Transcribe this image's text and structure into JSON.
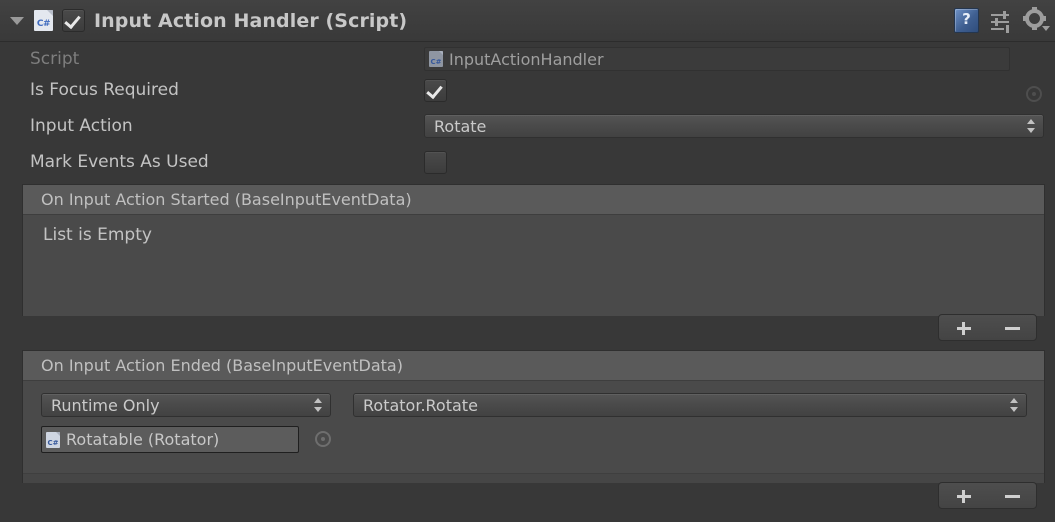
{
  "component": {
    "title": "Input Action Handler (Script)",
    "enabled_checkbox": true,
    "foldout_expanded": true,
    "icons": {
      "foldout": "triangle-down-icon",
      "script": "csharp-script-icon",
      "help": "help-book-icon",
      "preset": "preset-sliders-icon",
      "settings": "gear-dropdown-icon"
    }
  },
  "properties": {
    "script": {
      "label": "Script",
      "value": "InputActionHandler",
      "disabled": true,
      "picker": "object-picker-icon"
    },
    "is_focus_required": {
      "label": "Is Focus Required",
      "checked": true
    },
    "input_action": {
      "label": "Input Action",
      "value": "Rotate"
    },
    "mark_events_as_used": {
      "label": "Mark Events As Used",
      "checked": false
    }
  },
  "events": [
    {
      "header": "On Input Action Started (BaseInputEventData)",
      "empty_text": "List is Empty",
      "entries": [],
      "add_label": "+",
      "remove_label": "−"
    },
    {
      "header": "On Input Action Ended (BaseInputEventData)",
      "empty_text": "",
      "entries": [
        {
          "call_state": "Runtime Only",
          "method": "Rotator.Rotate",
          "target_object": "Rotatable (Rotator)",
          "target_icon": "csharp-script-icon",
          "picker": "object-picker-icon"
        }
      ],
      "add_label": "+",
      "remove_label": "−"
    }
  ],
  "colors": {
    "background": "#383838",
    "header_bg": "#3d3d3d",
    "event_box": "#4a4a4a",
    "event_header": "#5a5a5a",
    "text": "#c3c3c3",
    "text_dim": "#7e7e7e",
    "csharp_blue": "#3f6bbf"
  }
}
